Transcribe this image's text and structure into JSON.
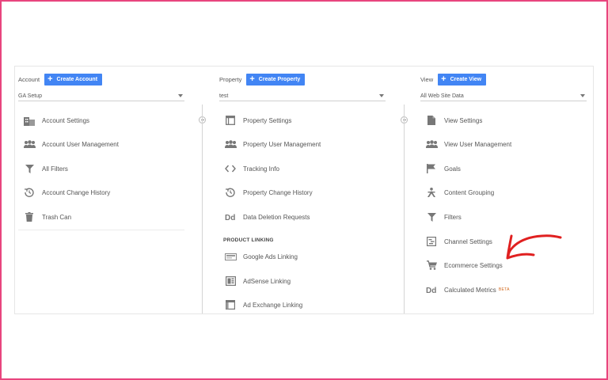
{
  "account": {
    "label": "Account",
    "create_label": "Create Account",
    "selected": "GA Setup",
    "items": [
      {
        "label": "Account Settings",
        "icon": "building-icon"
      },
      {
        "label": "Account User Management",
        "icon": "users-icon"
      },
      {
        "label": "All Filters",
        "icon": "filter-icon"
      },
      {
        "label": "Account Change History",
        "icon": "history-icon"
      },
      {
        "label": "Trash Can",
        "icon": "trash-icon"
      }
    ]
  },
  "property": {
    "label": "Property",
    "create_label": "Create Property",
    "selected": "test",
    "items": [
      {
        "label": "Property Settings",
        "icon": "window-icon"
      },
      {
        "label": "Property User Management",
        "icon": "users-icon"
      },
      {
        "label": "Tracking Info",
        "icon": "code-icon"
      },
      {
        "label": "Property Change History",
        "icon": "history-icon"
      },
      {
        "label": "Data Deletion Requests",
        "icon": "dd-icon"
      }
    ],
    "section_title": "PRODUCT LINKING",
    "linking": [
      {
        "label": "Google Ads Linking",
        "icon": "google-ads-icon"
      },
      {
        "label": "AdSense Linking",
        "icon": "adsense-icon"
      },
      {
        "label": "Ad Exchange Linking",
        "icon": "ad-exchange-icon"
      }
    ]
  },
  "view": {
    "label": "View",
    "create_label": "Create View",
    "selected": "All Web Site Data",
    "items": [
      {
        "label": "View Settings",
        "icon": "document-icon"
      },
      {
        "label": "View User Management",
        "icon": "users-icon"
      },
      {
        "label": "Goals",
        "icon": "flag-icon"
      },
      {
        "label": "Content Grouping",
        "icon": "person-icon"
      },
      {
        "label": "Filters",
        "icon": "filter-icon"
      },
      {
        "label": "Channel Settings",
        "icon": "channel-icon"
      },
      {
        "label": "Ecommerce Settings",
        "icon": "cart-icon"
      },
      {
        "label": "Calculated Metrics",
        "icon": "dd-icon",
        "badge": "BETA"
      }
    ]
  },
  "colors": {
    "accent": "#4285f4",
    "frame": "#e8457e",
    "annotation": "#e02020",
    "beta": "#d2691e"
  }
}
